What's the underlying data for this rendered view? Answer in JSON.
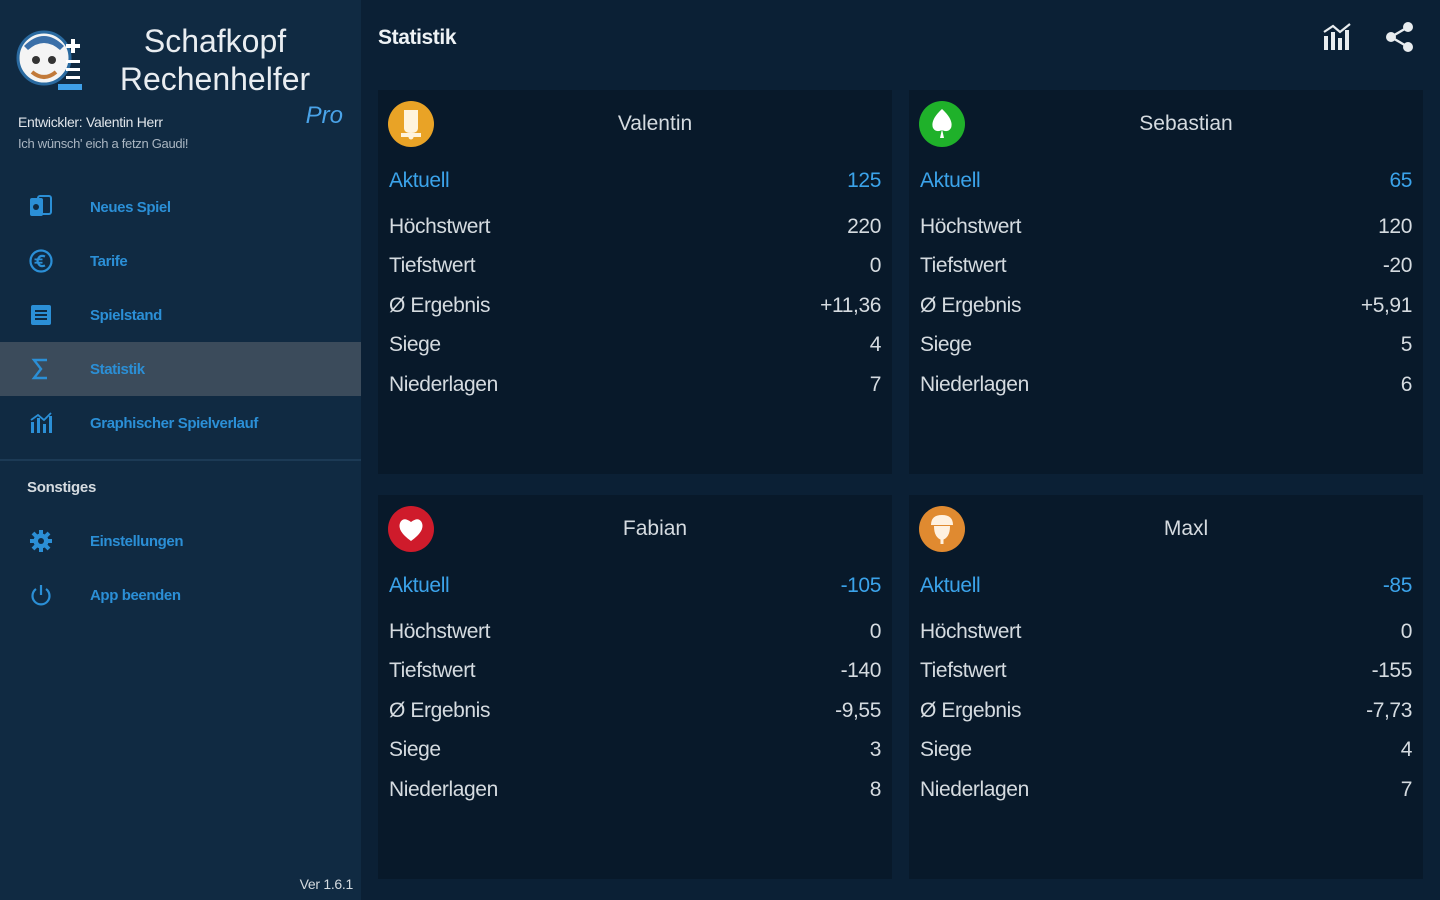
{
  "app": {
    "title_line1": "Schafkopf",
    "title_line2": "Rechenhelfer",
    "edition": "Pro",
    "developer": "Entwickler: Valentin Herr",
    "slogan": "Ich wünsch' eich a fetzn Gaudi!",
    "version": "Ver 1.6.1"
  },
  "nav": {
    "items": [
      {
        "label": "Neues Spiel",
        "icon": "cards-icon"
      },
      {
        "label": "Tarife",
        "icon": "euro-icon"
      },
      {
        "label": "Spielstand",
        "icon": "list-icon"
      },
      {
        "label": "Statistik",
        "icon": "sigma-icon"
      },
      {
        "label": "Graphischer Spielverlauf",
        "icon": "chart-icon"
      }
    ],
    "active_index": 3,
    "section_label": "Sonstiges",
    "other_items": [
      {
        "label": "Einstellungen",
        "icon": "gear-icon"
      },
      {
        "label": "App beenden",
        "icon": "power-icon"
      }
    ]
  },
  "header": {
    "title": "Statistik",
    "actions": [
      "chart-icon",
      "share-icon"
    ]
  },
  "labels": {
    "current": "Aktuell",
    "max": "Höchstwert",
    "min": "Tiefstwert",
    "avg": "Ø Ergebnis",
    "wins": "Siege",
    "losses": "Niederlagen"
  },
  "players": [
    {
      "name": "Valentin",
      "suit": "bell-icon",
      "suit_color": "#e9a326",
      "current": "125",
      "max": "220",
      "min": "0",
      "avg": "+11,36",
      "wins": "4",
      "losses": "7"
    },
    {
      "name": "Sebastian",
      "suit": "leaf-icon",
      "suit_color": "#1fb12a",
      "current": "65",
      "max": "120",
      "min": "-20",
      "avg": "+5,91",
      "wins": "5",
      "losses": "6"
    },
    {
      "name": "Fabian",
      "suit": "heart-icon",
      "suit_color": "#cf1b2b",
      "current": "-105",
      "max": "0",
      "min": "-140",
      "avg": "-9,55",
      "wins": "3",
      "losses": "8"
    },
    {
      "name": "Maxl",
      "suit": "acorn-icon",
      "suit_color": "#e08a30",
      "current": "-85",
      "max": "0",
      "min": "-155",
      "avg": "-7,73",
      "wins": "4",
      "losses": "7"
    }
  ],
  "colors": {
    "accent": "#3ba3ea",
    "sidebar_bg": "#102a42",
    "page_bg": "#0b2035",
    "card_bg": "#08192a",
    "active_bg": "#3b4b5b"
  }
}
